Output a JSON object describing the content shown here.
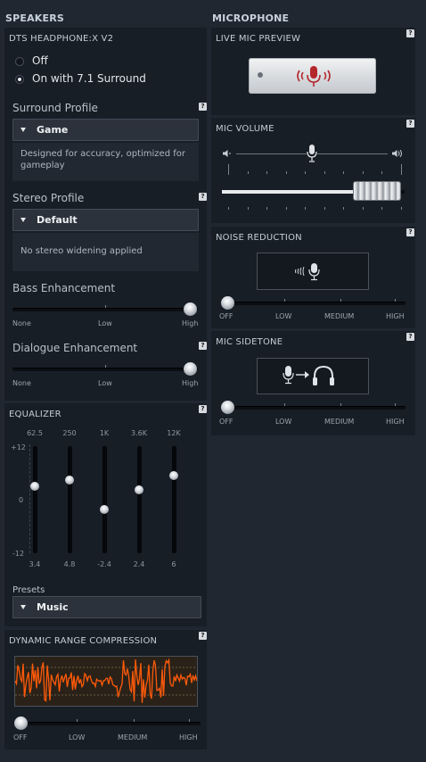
{
  "speakers": {
    "title": "SPEAKERS",
    "dts": {
      "title": "DTS HEADPHONE:X V2",
      "options": [
        {
          "label": "Off",
          "selected": false
        },
        {
          "label": "On with 7.1 Surround",
          "selected": true
        }
      ],
      "surround_profile": {
        "label": "Surround Profile",
        "value": "Game",
        "description": "Designed for accuracy, optimized for gameplay"
      },
      "stereo_profile": {
        "label": "Stereo Profile",
        "value": "Default",
        "description": "No stereo widening applied"
      },
      "bass": {
        "label": "Bass Enhancement",
        "min": "None",
        "mid": "Low",
        "max": "High",
        "level": 1.0
      },
      "dialogue": {
        "label": "Dialogue Enhancement",
        "min": "None",
        "mid": "Low",
        "max": "High",
        "level": 1.0
      }
    },
    "equalizer": {
      "title": "EQUALIZER",
      "axis": {
        "top": "+12",
        "mid": "0",
        "bottom": "-12"
      },
      "bands": [
        {
          "freq": "62.5",
          "value": "3.4",
          "db": 3.4
        },
        {
          "freq": "250",
          "value": "4.8",
          "db": 4.8
        },
        {
          "freq": "1K",
          "value": "-2.4",
          "db": -2.4
        },
        {
          "freq": "3.6K",
          "value": "2.4",
          "db": 2.4
        },
        {
          "freq": "12K",
          "value": "6",
          "db": 6
        }
      ],
      "presets_label": "Presets",
      "preset": "Music"
    },
    "drc": {
      "title": "DYNAMIC RANGE COMPRESSION",
      "levels": [
        "OFF",
        "LOW",
        "MEDIUM",
        "HIGH"
      ],
      "level": 0,
      "waveform_color": "#ff5a0a"
    }
  },
  "microphone": {
    "title": "MICROPHONE",
    "live_preview": {
      "title": "LIVE MIC PREVIEW"
    },
    "volume": {
      "title": "MIC VOLUME",
      "level": 0.85
    },
    "noise_reduction": {
      "title": "NOISE REDUCTION",
      "levels": [
        "OFF",
        "LOW",
        "MEDIUM",
        "HIGH"
      ],
      "level": 0
    },
    "sidetone": {
      "title": "MIC SIDETONE",
      "levels": [
        "OFF",
        "LOW",
        "MEDIUM",
        "HIGH"
      ],
      "level": 0
    }
  },
  "help_label": "?",
  "colors": {
    "accent_red": "#b3262b",
    "waveform": "#ff5a0a"
  }
}
